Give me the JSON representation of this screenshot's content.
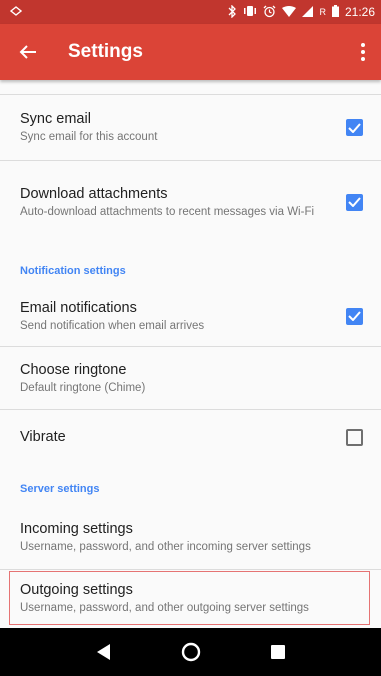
{
  "status_bar": {
    "icons": [
      "notification-icon",
      "bluetooth-icon",
      "vibrate-icon",
      "alarm-icon",
      "wifi-icon",
      "signal-icon",
      "roaming-indicator",
      "battery-icon"
    ],
    "roaming": "R",
    "time": "21:26"
  },
  "app_bar": {
    "title": "Settings",
    "back_icon": "arrow-back-icon",
    "menu_icon": "more-vert-icon"
  },
  "colors": {
    "status_bar": "#c1362e",
    "app_bar": "#db4437",
    "accent": "#4285f4",
    "highlight": "#e57373"
  },
  "settings": {
    "sync_email": {
      "title": "Sync email",
      "summary": "Sync email for this account",
      "checked": true
    },
    "download_attachments": {
      "title": "Download attachments",
      "summary": "Auto-download attachments to recent messages via Wi-Fi",
      "checked": true
    },
    "notification_section": "Notification settings",
    "email_notifications": {
      "title": "Email notifications",
      "summary": "Send notification when email arrives",
      "checked": true
    },
    "choose_ringtone": {
      "title": "Choose ringtone",
      "summary": "Default ringtone (Chime)"
    },
    "vibrate": {
      "title": "Vibrate",
      "checked": false
    },
    "server_section": "Server settings",
    "incoming_settings": {
      "title": "Incoming settings",
      "summary": "Username, password, and other incoming server settings"
    },
    "outgoing_settings": {
      "title": "Outgoing settings",
      "summary": "Username, password, and other outgoing server settings"
    }
  },
  "nav_bar": {
    "icons": [
      "back-triangle-icon",
      "home-circle-icon",
      "recents-square-icon"
    ]
  }
}
